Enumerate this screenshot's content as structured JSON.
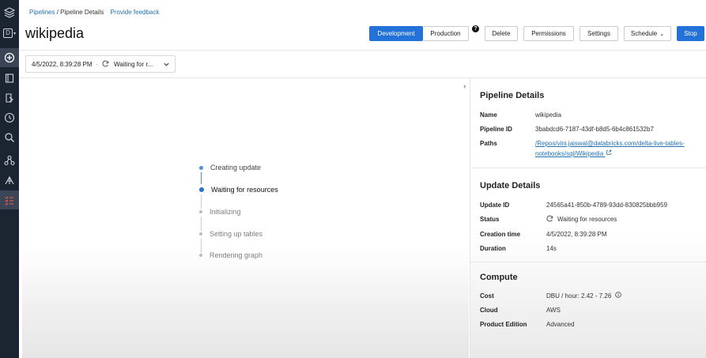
{
  "nav": {
    "workspace_letter": "D"
  },
  "breadcrumb": {
    "parent": "Pipelines",
    "separator": "/",
    "current": "Pipeline Details",
    "feedback": "Provide feedback"
  },
  "page_title": "wikipedia",
  "toolbar": {
    "development": "Development",
    "production": "Production",
    "help": "?",
    "delete": "Delete",
    "permissions": "Permissions",
    "settings": "Settings",
    "schedule": "Schedule",
    "stop": "Stop"
  },
  "update_selector": {
    "timestamp": "4/5/2022, 8:39:28 PM",
    "separator": "·",
    "status": "Waiting for r..."
  },
  "progress_steps": [
    {
      "label": "Creating update",
      "state": "done"
    },
    {
      "label": "Waiting for resources",
      "state": "active"
    },
    {
      "label": "Initializing",
      "state": "pending"
    },
    {
      "label": "Setting up tables",
      "state": "pending"
    },
    {
      "label": "Rendering graph",
      "state": "pending"
    }
  ],
  "pipeline_details": {
    "title": "Pipeline Details",
    "name_label": "Name",
    "name_value": "wikipedia",
    "id_label": "Pipeline ID",
    "id_value": "3babdcd6-7187-43df-b8d5-6b4c861532b7",
    "paths_label": "Paths",
    "paths_value": "/Repos/vini.jaiswal@databricks.com/delta-live-tables-notebooks/sql/Wikipedia"
  },
  "update_details": {
    "title": "Update Details",
    "id_label": "Update ID",
    "id_value": "24565a41-850b-4789-93dd-830825bbb959",
    "status_label": "Status",
    "status_value": "Waiting for resources",
    "creation_label": "Creation time",
    "creation_value": "4/5/2022, 8:39:28 PM",
    "duration_label": "Duration",
    "duration_value": "14s"
  },
  "compute": {
    "title": "Compute",
    "cost_label": "Cost",
    "cost_value": "DBU / hour: 2.42 - 7.26",
    "cloud_label": "Cloud",
    "cloud_value": "AWS",
    "edition_label": "Product Edition",
    "edition_value": "Advanced"
  },
  "colors": {
    "accent": "#2272d9",
    "link": "#2272b4",
    "nav_bg": "#1b2431"
  }
}
